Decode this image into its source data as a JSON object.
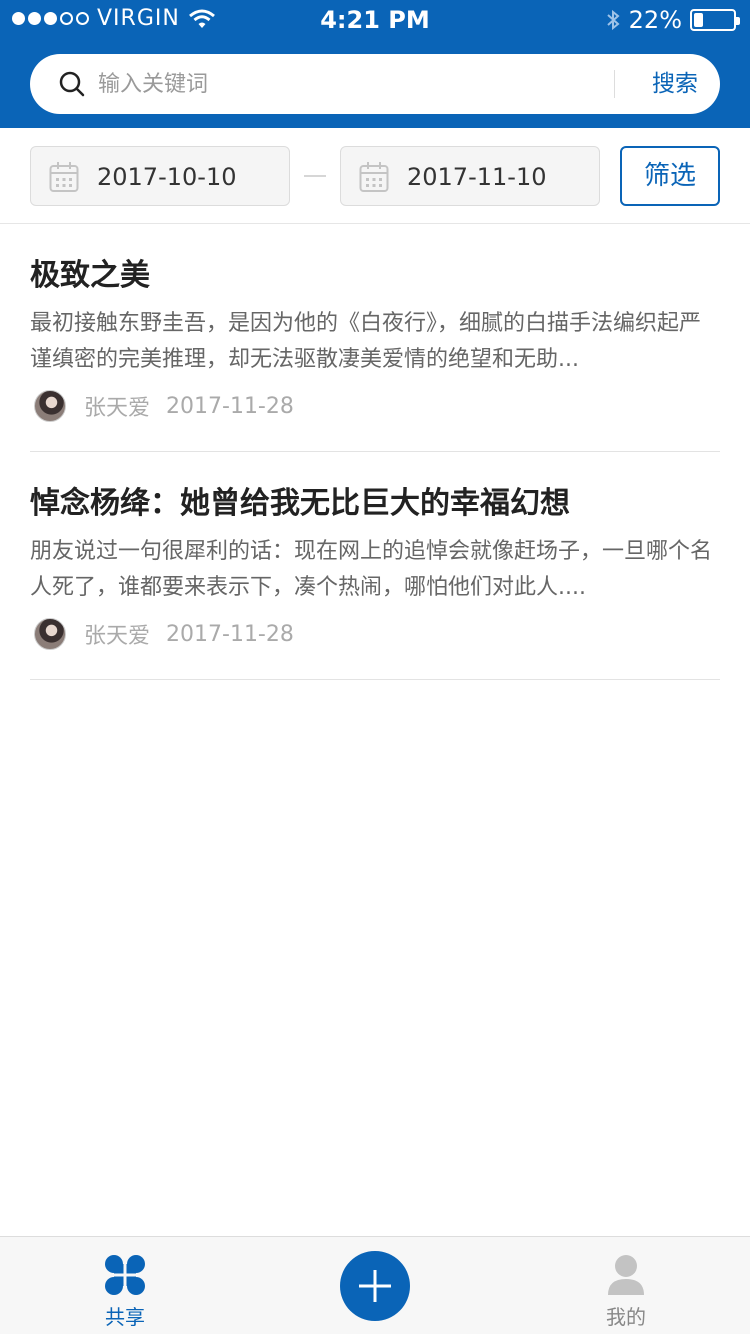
{
  "status_bar": {
    "carrier": "VIRGIN",
    "time": "4:21 PM",
    "battery_percent": "22%",
    "battery_level": 0.22,
    "signal_dots_filled": 3,
    "signal_dots_total": 5,
    "icons": [
      "wifi-icon",
      "bluetooth-icon",
      "battery-icon"
    ]
  },
  "search": {
    "placeholder": "输入关键词",
    "value": "",
    "button_label": "搜索",
    "icon": "search-icon"
  },
  "filters": {
    "start_date": "2017-10-10",
    "end_date": "2017-11-10",
    "button_label": "筛选",
    "icon": "calendar-icon"
  },
  "articles": [
    {
      "title": "极致之美",
      "excerpt": "最初接触东野圭吾，是因为他的《白夜行》，细腻的白描手法编织起严谨缜密的完美推理，却无法驱散凄美爱情的绝望和无助...",
      "author": "张天爱",
      "date": "2017-11-28"
    },
    {
      "title": "悼念杨绛：她曾给我无比巨大的幸福幻想",
      "excerpt": "朋友说过一句很犀利的话：现在网上的追悼会就像赶场子，一旦哪个名人死了，谁都要来表示下，凑个热闹，哪怕他们对此人....",
      "author": "张天爱",
      "date": "2017-11-28"
    }
  ],
  "tabbar": {
    "share_label": "共享",
    "mine_label": "我的",
    "active_tab": "共享",
    "icons": [
      "clover-icon",
      "plus-icon",
      "user-icon"
    ]
  },
  "colors": {
    "primary": "#0a64b7",
    "background": "#ffffff",
    "muted_text": "#aaaaaa"
  }
}
